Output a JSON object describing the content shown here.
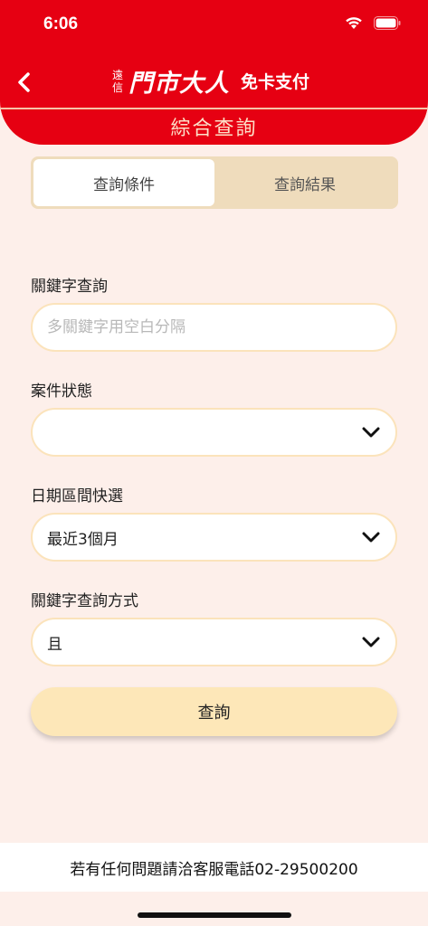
{
  "status_bar": {
    "time": "6:06"
  },
  "header": {
    "back_icon": "chevron-left-icon",
    "brand_small_top": "遠",
    "brand_small_bottom": "信",
    "brand_logo": "門市大人",
    "brand_service": "免卡支付",
    "title": "綜合查詢"
  },
  "tabs": [
    {
      "label": "查詢條件",
      "active": true
    },
    {
      "label": "查詢結果",
      "active": false
    }
  ],
  "form": {
    "keyword": {
      "label": "關鍵字查詢",
      "placeholder": "多關鍵字用空白分隔",
      "value": ""
    },
    "case_status": {
      "label": "案件狀態",
      "value": ""
    },
    "date_range": {
      "label": "日期區間快選",
      "value": "最近3個月"
    },
    "keyword_mode": {
      "label": "關鍵字查詢方式",
      "value": "且"
    },
    "submit_label": "查詢"
  },
  "footer": {
    "text": "若有任何問題請洽客服電話02-29500200"
  },
  "colors": {
    "brand_red": "#e60012",
    "background": "#fdefea",
    "tab_bg": "#efdcbc",
    "button_bg": "#fde7b8",
    "field_border": "#fbe3bb"
  }
}
